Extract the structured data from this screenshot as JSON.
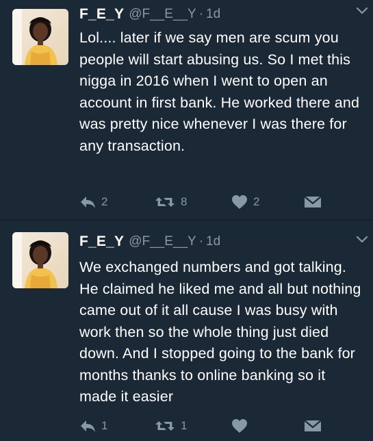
{
  "colors": {
    "background": "#1b2836",
    "text": "#ffffff",
    "muted": "#8899a6"
  },
  "tweets": [
    {
      "display_name": "F_E_Y",
      "handle": "@F__E__Y",
      "separator": "·",
      "time": "1d",
      "text": "Lol.... later if we say men are scum you people will start abusing us. So I met this nigga in 2016 when I went to open an account in first bank. He worked there and was pretty nice whenever I was there for any transaction.",
      "reply_count": "2",
      "retweet_count": "8",
      "like_count": "2",
      "icons": [
        "reply-icon",
        "retweet-icon",
        "heart-icon",
        "direct-message-icon",
        "chevron-down-icon"
      ]
    },
    {
      "display_name": "F_E_Y",
      "handle": "@F__E__Y",
      "separator": "·",
      "time": "1d",
      "text": "We exchanged numbers and got talking. He claimed he liked me and all but nothing came out of it all cause I was busy with work then so the whole thing just died down. And I stopped going to the bank for months thanks to online banking so it made it easier",
      "reply_count": "1",
      "retweet_count": "1",
      "like_count": "",
      "icons": [
        "reply-icon",
        "retweet-icon",
        "heart-icon",
        "direct-message-icon",
        "chevron-down-icon"
      ]
    }
  ]
}
